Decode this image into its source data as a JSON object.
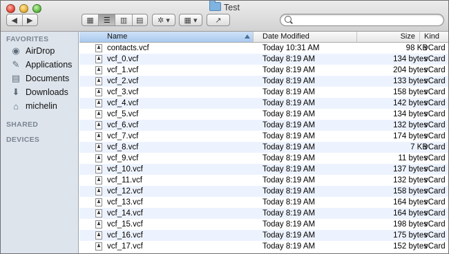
{
  "window": {
    "title": "Test"
  },
  "toolbar": {
    "back_icon": "◀",
    "forward_icon": "▶",
    "view_icons": "▦",
    "view_list": "☰",
    "view_columns": "▥",
    "view_coverflow": "▤",
    "action_icon": "✲ ▾",
    "arrange_icon": "▦ ▾",
    "share_icon": "↗",
    "search_placeholder": ""
  },
  "sidebar": {
    "favorites_label": "FAVORITES",
    "items": [
      {
        "label": "AirDrop",
        "icon": "airdrop-icon",
        "glyph": "◉"
      },
      {
        "label": "Applications",
        "icon": "applications-icon",
        "glyph": "✎"
      },
      {
        "label": "Documents",
        "icon": "documents-icon",
        "glyph": "▤"
      },
      {
        "label": "Downloads",
        "icon": "downloads-icon",
        "glyph": "⬇"
      },
      {
        "label": "michelin",
        "icon": "home-icon",
        "glyph": "⌂"
      }
    ],
    "shared_label": "SHARED",
    "devices_label": "DEVICES"
  },
  "columns": {
    "name": "Name",
    "date": "Date Modified",
    "size": "Size",
    "kind": "Kind"
  },
  "files": [
    {
      "name": "contacts.vcf",
      "date": "Today 10:31 AM",
      "size": "98 KB",
      "kind": "vCard"
    },
    {
      "name": "vcf_0.vcf",
      "date": "Today 8:19 AM",
      "size": "134 bytes",
      "kind": "vCard"
    },
    {
      "name": "vcf_1.vcf",
      "date": "Today 8:19 AM",
      "size": "204 bytes",
      "kind": "vCard"
    },
    {
      "name": "vcf_2.vcf",
      "date": "Today 8:19 AM",
      "size": "133 bytes",
      "kind": "vCard"
    },
    {
      "name": "vcf_3.vcf",
      "date": "Today 8:19 AM",
      "size": "158 bytes",
      "kind": "vCard"
    },
    {
      "name": "vcf_4.vcf",
      "date": "Today 8:19 AM",
      "size": "142 bytes",
      "kind": "vCard"
    },
    {
      "name": "vcf_5.vcf",
      "date": "Today 8:19 AM",
      "size": "134 bytes",
      "kind": "vCard"
    },
    {
      "name": "vcf_6.vcf",
      "date": "Today 8:19 AM",
      "size": "132 bytes",
      "kind": "vCard"
    },
    {
      "name": "vcf_7.vcf",
      "date": "Today 8:19 AM",
      "size": "174 bytes",
      "kind": "vCard"
    },
    {
      "name": "vcf_8.vcf",
      "date": "Today 8:19 AM",
      "size": "7 KB",
      "kind": "vCard"
    },
    {
      "name": "vcf_9.vcf",
      "date": "Today 8:19 AM",
      "size": "11 bytes",
      "kind": "vCard"
    },
    {
      "name": "vcf_10.vcf",
      "date": "Today 8:19 AM",
      "size": "137 bytes",
      "kind": "vCard"
    },
    {
      "name": "vcf_11.vcf",
      "date": "Today 8:19 AM",
      "size": "132 bytes",
      "kind": "vCard"
    },
    {
      "name": "vcf_12.vcf",
      "date": "Today 8:19 AM",
      "size": "158 bytes",
      "kind": "vCard"
    },
    {
      "name": "vcf_13.vcf",
      "date": "Today 8:19 AM",
      "size": "164 bytes",
      "kind": "vCard"
    },
    {
      "name": "vcf_14.vcf",
      "date": "Today 8:19 AM",
      "size": "164 bytes",
      "kind": "vCard"
    },
    {
      "name": "vcf_15.vcf",
      "date": "Today 8:19 AM",
      "size": "198 bytes",
      "kind": "vCard"
    },
    {
      "name": "vcf_16.vcf",
      "date": "Today 8:19 AM",
      "size": "175 bytes",
      "kind": "vCard"
    },
    {
      "name": "vcf_17.vcf",
      "date": "Today 8:19 AM",
      "size": "152 bytes",
      "kind": "vCard"
    }
  ]
}
